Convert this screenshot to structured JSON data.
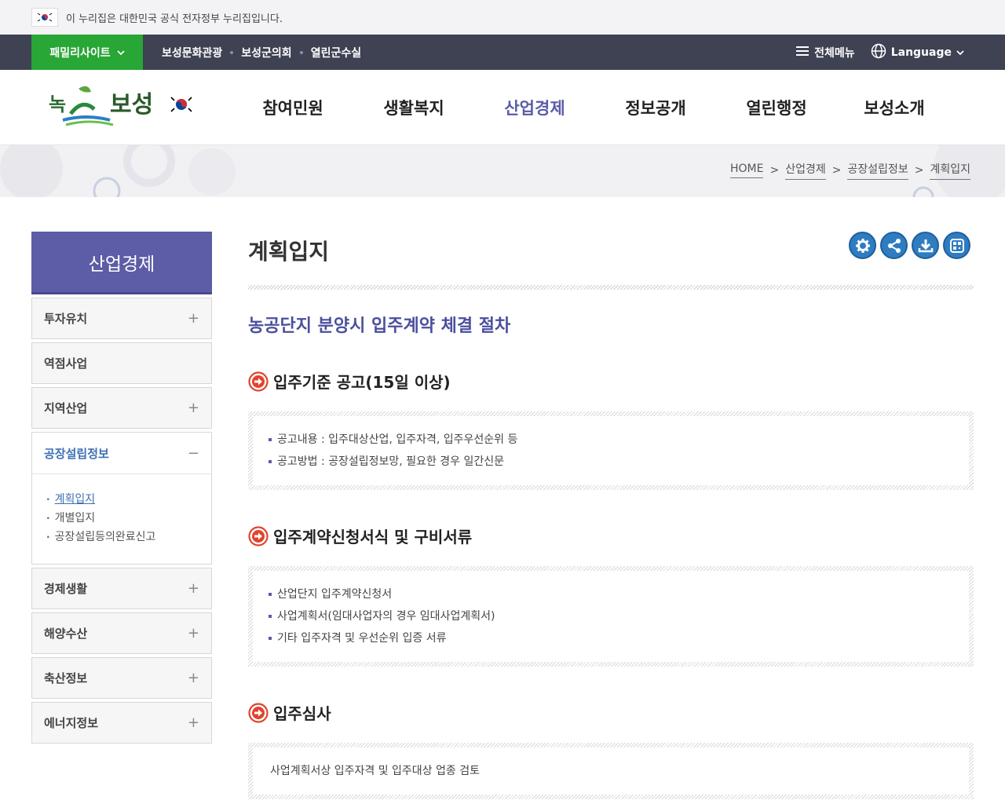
{
  "gov": {
    "notice": "이 누리집은 대한민국 공식 전자정부 누리집입니다."
  },
  "util": {
    "family_label": "패밀리사이트",
    "links": [
      "보성문화관광",
      "보성군의회",
      "열린군수실"
    ],
    "all_menu": "전체메뉴",
    "language": "Language"
  },
  "header": {
    "logo_text": "녹차수도 보성",
    "gnb": [
      "참여민원",
      "생활복지",
      "산업경제",
      "정보공개",
      "열린행정",
      "보성소개"
    ],
    "active_index": 2
  },
  "breadcrumb": [
    "HOME",
    "산업경제",
    "공장설립정보",
    "계획입지"
  ],
  "sidebar": {
    "title": "산업경제",
    "items": [
      {
        "label": "투자유치",
        "toggle": "+"
      },
      {
        "label": "역점사업",
        "toggle": ""
      },
      {
        "label": "지역산업",
        "toggle": "+"
      },
      {
        "label": "공장설립정보",
        "toggle": "−"
      },
      {
        "label": "경제생활",
        "toggle": "+"
      },
      {
        "label": "해양수산",
        "toggle": "+"
      },
      {
        "label": "축산정보",
        "toggle": "+"
      },
      {
        "label": "에너지정보",
        "toggle": "+"
      }
    ],
    "sub_items": [
      "계획입지",
      "개별입지",
      "공장설립등의완료신고"
    ]
  },
  "content": {
    "page_title": "계획입지",
    "section_heading": "농공단지 분양시 입주계약 체결 절차",
    "steps": [
      {
        "title": "입주기준 공고(15일 이상)",
        "items": [
          "공고내용 : 입주대상산업, 입주자격, 입주우선순위 등",
          "공고방법 : 공장설립정보망, 필요한 경우 일간신문"
        ]
      },
      {
        "title": "입주계약신청서식 및 구비서류",
        "items": [
          "산업단지 입주계약신청서",
          "사업계획서(임대사업자의 경우 임대사업계획서)",
          "기타 입주자격 및 우선순위 입증 서류"
        ]
      },
      {
        "title": "입주심사",
        "text": "사업계획서상 입주자격 및 입주대상 업종 검토"
      }
    ]
  },
  "colors": {
    "util_bar": "#3e4253",
    "family_green": "#28a636",
    "accent_purple": "#5d5ca6",
    "tool_blue": "#2f7cc1",
    "step_icon_red": "#e0442d"
  }
}
